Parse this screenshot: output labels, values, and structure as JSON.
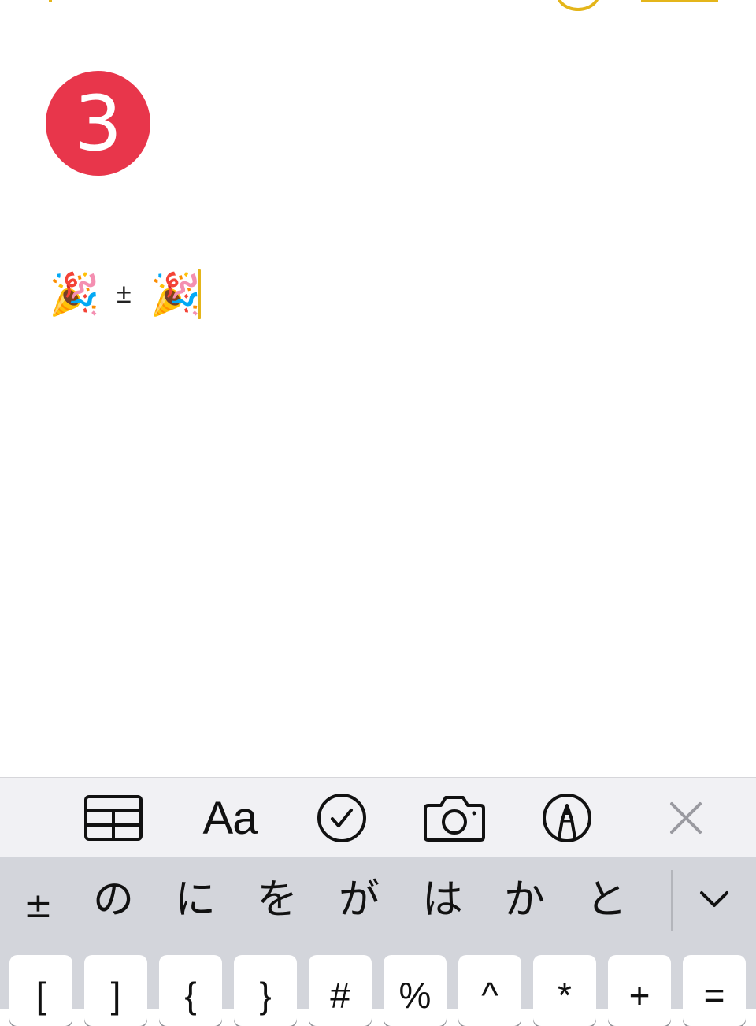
{
  "note": {
    "step_number": "3",
    "line": {
      "emoji_left": "🎉",
      "symbol": "±",
      "emoji_right": "🎉"
    }
  },
  "toolbar": {
    "icons": [
      "table-icon",
      "format-text-icon",
      "checklist-icon",
      "camera-icon",
      "markup-pen-icon",
      "close-icon"
    ],
    "format_label": "Aa"
  },
  "keyboard": {
    "candidates": [
      "±",
      "の",
      "に",
      "を",
      "が",
      "は",
      "か",
      "と"
    ],
    "expand_icon": "chevron-down-icon",
    "keys": [
      "[",
      "]",
      "{",
      "}",
      "#",
      "%",
      "^",
      "*",
      "+",
      "="
    ]
  },
  "colors": {
    "accent": "#e4b51a",
    "badge": "#e8364b",
    "toolbar_bg": "#f1f1f4",
    "keyboard_bg": "#d3d5db"
  }
}
